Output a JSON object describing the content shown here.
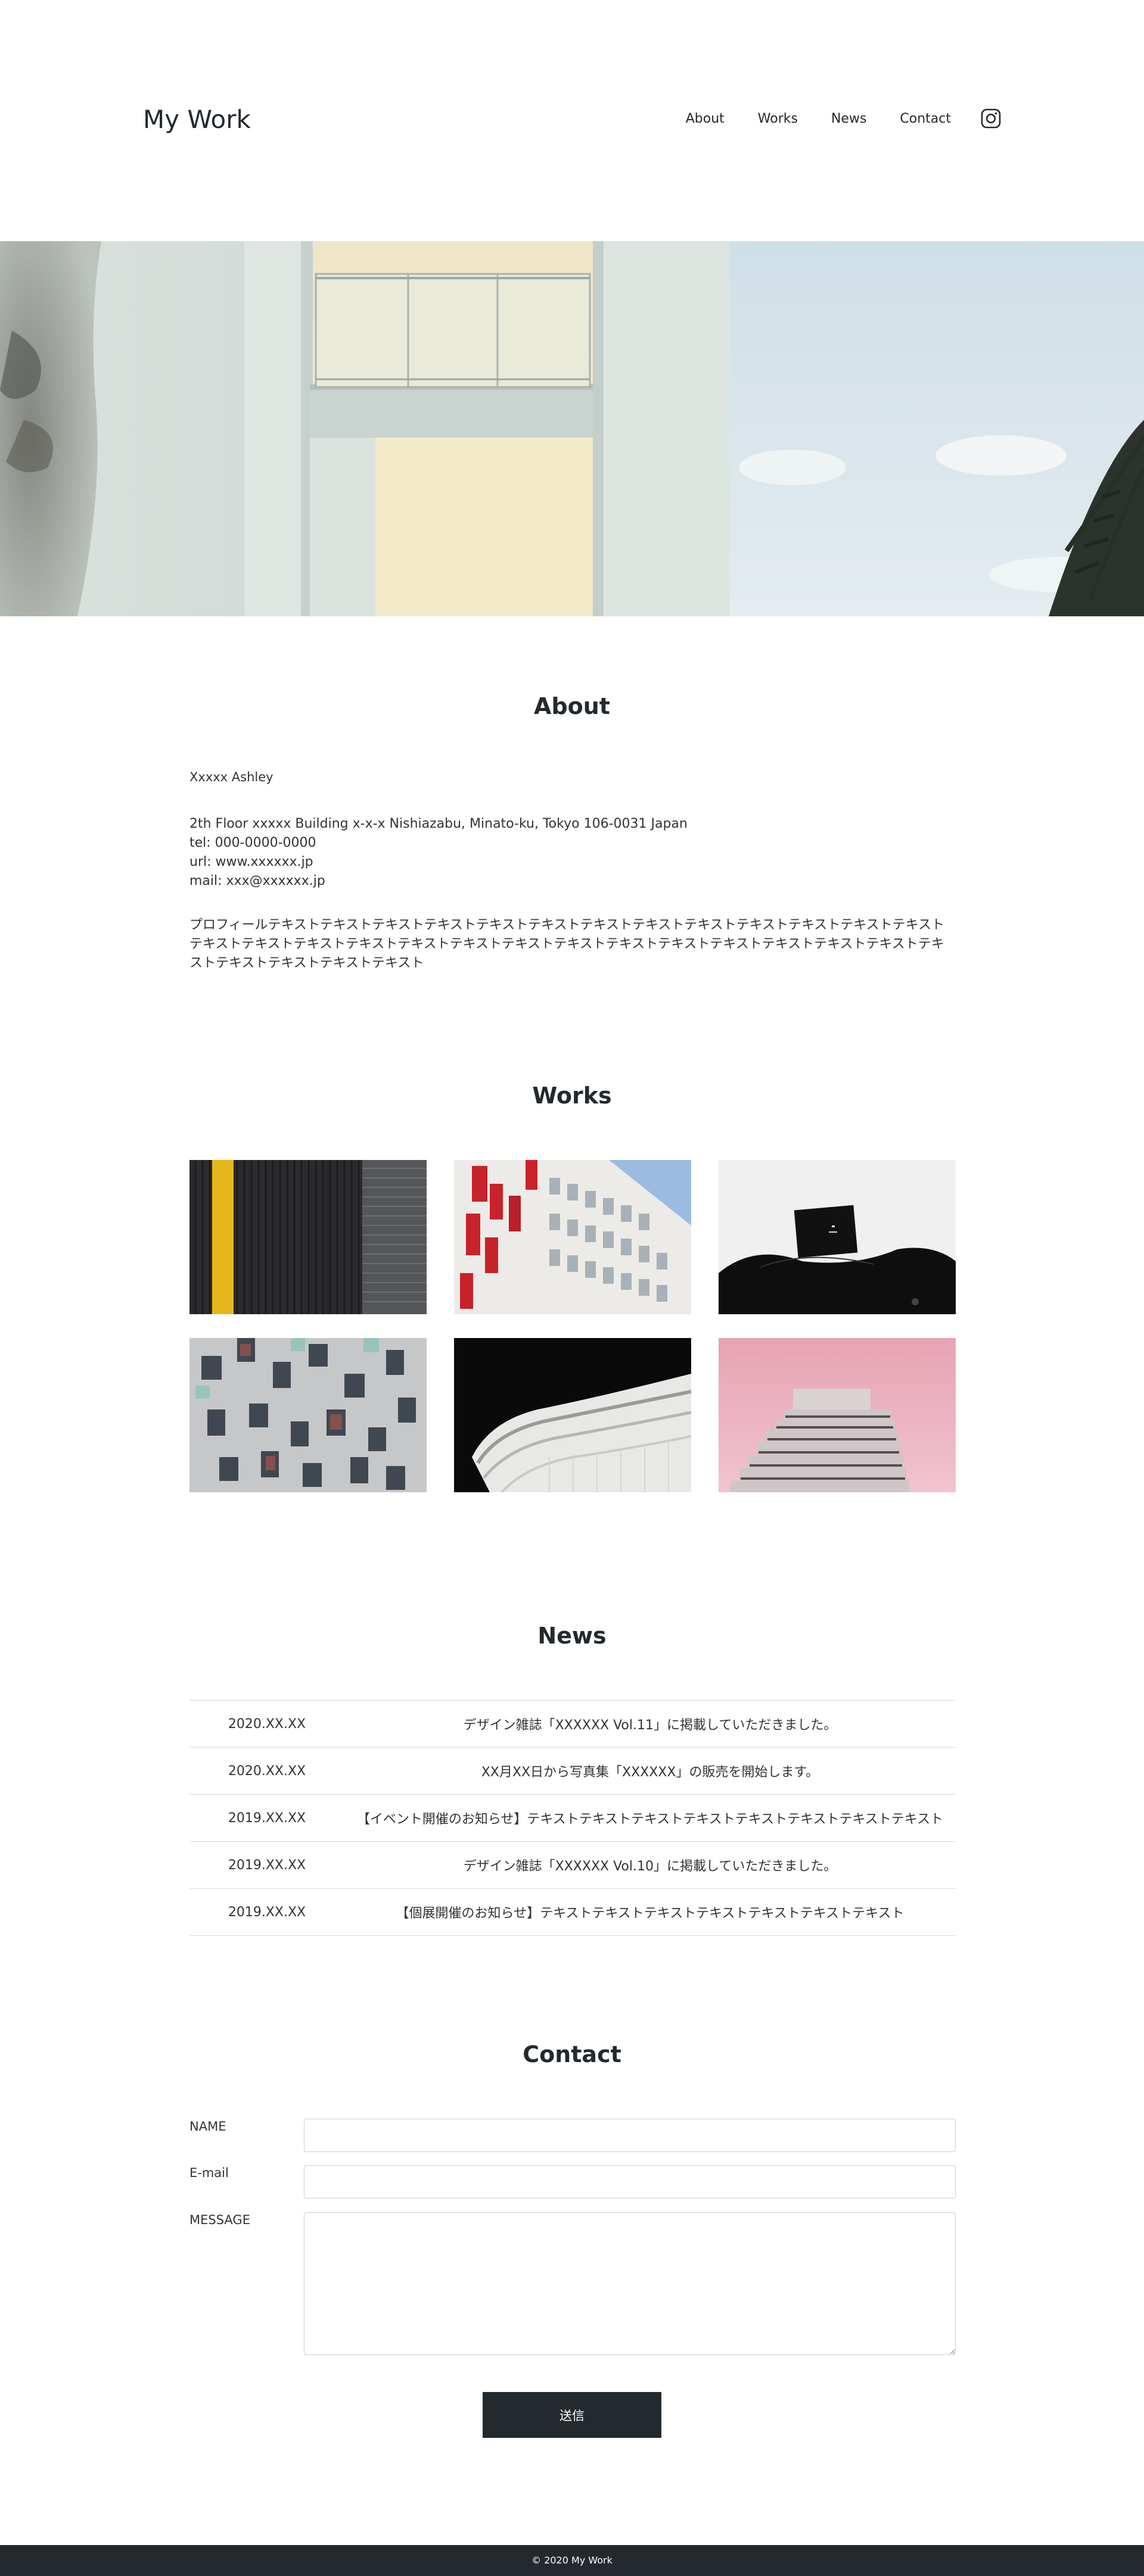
{
  "header": {
    "logo": "My Work",
    "nav": [
      "About",
      "Works",
      "News",
      "Contact"
    ],
    "instagram_icon": "instagram-icon"
  },
  "about": {
    "title": "About",
    "name": "Xxxxx Ashley",
    "address": [
      "2th Floor xxxxx Building x-x-x Nishiazabu, Minato-ku, Tokyo 106-0031 Japan",
      "tel: 000-0000-0000",
      "url: www.xxxxxx.jp",
      "mail: xxx@xxxxxx.jp"
    ],
    "profile": "プロフィールテキストテキストテキストテキストテキストテキストテキストテキストテキストテキストテキストテキストテキストテキストテキストテキストテキストテキストテキストテキストテキストテキストテキストテキストテキストテキストテキストテキストテキストテキストテキストテキスト"
  },
  "works": {
    "title": "Works",
    "items": [
      "yellow-stripe-building",
      "red-white-facade",
      "black-chair-still-life",
      "windowed-concrete-facade",
      "curved-white-balconies",
      "pink-sky-tower"
    ]
  },
  "news": {
    "title": "News",
    "items": [
      {
        "date": "2020.XX.XX",
        "text": "デザイン雑誌「XXXXXX Vol.11」に掲載していただきました。"
      },
      {
        "date": "2020.XX.XX",
        "text": "XX月XX日から写真集「XXXXXX」の販売を開始します。"
      },
      {
        "date": "2019.XX.XX",
        "text": "【イベント開催のお知らせ】テキストテキストテキストテキストテキストテキストテキストテキスト"
      },
      {
        "date": "2019.XX.XX",
        "text": "デザイン雑誌「XXXXXX Vol.10」に掲載していただきました。"
      },
      {
        "date": "2019.XX.XX",
        "text": "【個展開催のお知らせ】テキストテキストテキストテキストテキストテキストテキスト"
      }
    ]
  },
  "contact": {
    "title": "Contact",
    "name_label": "NAME",
    "email_label": "E-mail",
    "message_label": "MESSAGE",
    "name_value": "",
    "email_value": "",
    "message_value": "",
    "submit_label": "送信"
  },
  "footer": {
    "copyright": "© 2020 My Work"
  },
  "colors": {
    "text": "#24292e",
    "button": "#24292e",
    "footer": "#24292e",
    "border": "#d6d6d6"
  }
}
